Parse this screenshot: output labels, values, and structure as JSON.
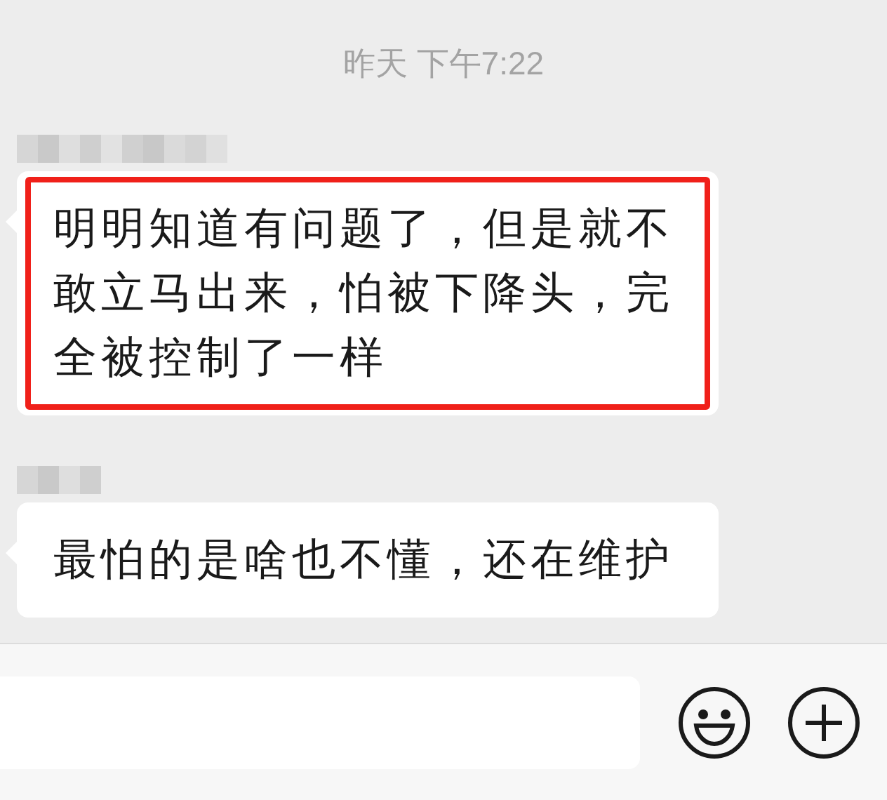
{
  "timestamp": "昨天 下午7:22",
  "messages": [
    {
      "sender_redacted": true,
      "text": "明明知道有问题了，但是就不敢立马出来，怕被下降头，完全被控制了一样",
      "highlighted": true
    },
    {
      "sender_redacted": true,
      "text": "最怕的是啥也不懂，还在维护",
      "highlighted": false
    }
  ]
}
